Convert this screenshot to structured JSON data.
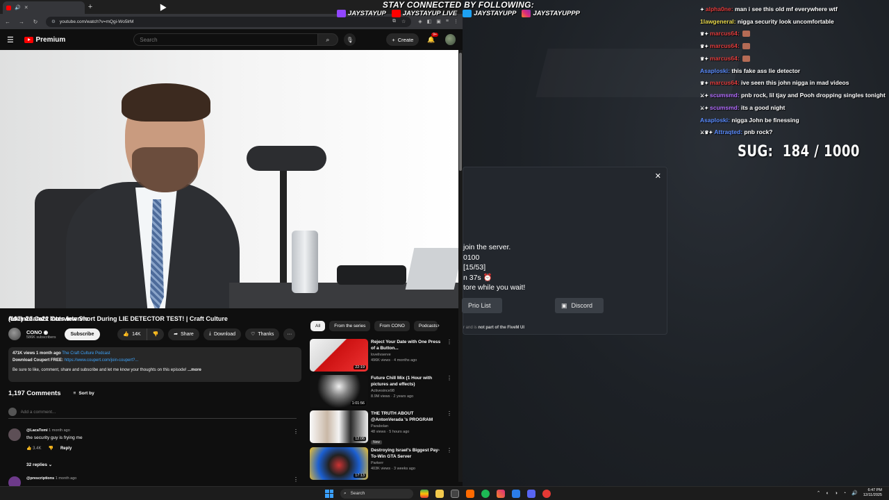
{
  "browser": {
    "tab_title": "(107) Adam22 Cuts Intervie",
    "url": "youtube.com/watch?v=mQgi-Wo5lrM"
  },
  "youtube": {
    "brand": "Premium",
    "search_placeholder": "Search",
    "create_label": "Create",
    "notif_count": "9+",
    "video_title": "Adam22 Cuts Interview Short During LIE DETECTOR TEST! | Craft Culture",
    "channel_name": "CONO",
    "channel_subs": "586K subscribers",
    "subscribe_label": "Subscribe",
    "likes": "14K",
    "share_label": "Share",
    "download_label": "Download",
    "thanks_label": "Thanks",
    "description": {
      "meta": "471K views  1 month ago",
      "podcast": "The Craft Culture Podcast",
      "coupon_label": "Download Coupert FREE:",
      "coupon_link": "https://www.coupert.com/join-coupert?...",
      "body": "Be sure to like, comment, share and subscribe and let me know your thoughts on this episode!",
      "more": "...more"
    },
    "comments_count": "1,197 Comments",
    "sort_label": "Sort by",
    "add_comment_placeholder": "Add a comment...",
    "comments": [
      {
        "author": "@LacaTomi",
        "time": "1 month ago",
        "text": "the security guy is frying me",
        "likes": "3.4K",
        "reply": "Reply"
      },
      {
        "author": "@prescriptions",
        "time": "1 month ago"
      }
    ],
    "replies_label": "32 replies",
    "chips": [
      "All",
      "From the series",
      "From CONO",
      "Podcasts"
    ],
    "recommendations": [
      {
        "title": "Reject Your Date with One Press of a Button...",
        "channel": "lovelivserve",
        "meta": "496K views · 4 months ago",
        "duration": "22:19"
      },
      {
        "title": "Future Chill Mix (1 Hour with pictures and effects)",
        "channel": "Activesince98",
        "meta": "8.9M views · 2 years ago",
        "duration": "1:01:56"
      },
      {
        "title": "THE TRUTH ABOUT @AntonVerada 's PROGRAM",
        "channel": "Parabolan",
        "meta": "48 views · 5 hours ago",
        "duration": "12:06",
        "badge": "New"
      },
      {
        "title": "Destroying Israel's Biggest Pay-To-Win GTA Server",
        "channel": "Parkerr",
        "meta": "403K views · 3 weeks ago",
        "duration": "17:13"
      }
    ]
  },
  "overlay": {
    "follow_title": "STAY CONNECTED BY FOLLOWING:",
    "handles": [
      "JAYSTAYUP",
      "JAYSTAYUP LIVE",
      "JAYSTAYUPP",
      "JAYSTAYUPPP"
    ],
    "sug_label": "SUG:",
    "sug_value": "184 / 1000",
    "chat": [
      {
        "user": "alpha0ne:",
        "msg": "man i see this old mf everywhere wtf",
        "color": "red"
      },
      {
        "user": "1lawgeneral:",
        "msg": "nigga security look uncomfortable",
        "color": "yellow"
      },
      {
        "user": "marcus64:",
        "msg": "",
        "color": "red"
      },
      {
        "user": "marcus64:",
        "msg": "",
        "color": "red"
      },
      {
        "user": "marcus64:",
        "msg": "",
        "color": "red"
      },
      {
        "user": "Asaploski:",
        "msg": "this fake ass lie detector",
        "color": "blue"
      },
      {
        "user": "marcus64:",
        "msg": "ive seen this john nigga in mad videos",
        "color": "red"
      },
      {
        "user": "scumsmd:",
        "msg": "pnb rock, lil tjay and Pooh dropping singles tonight",
        "color": "purple"
      },
      {
        "user": "scumsmd:",
        "msg": "its a good night",
        "color": "purple"
      },
      {
        "user": "Asaploski:",
        "msg": "nigga John be finessing",
        "color": "blue"
      },
      {
        "user": "Attraqted:",
        "msg": "pnb rock?",
        "color": "blue"
      }
    ],
    "queue": {
      "lines": [
        "join the server.",
        "0100",
        "[15/53]",
        "n 37s ⏰",
        "tore while you wait!"
      ],
      "prio_label": "Prio List",
      "discord_label": "Discord",
      "note_prefix": "r and is",
      "note_bold": "not part of the FiveM UI"
    }
  },
  "taskbar": {
    "search_label": "Search",
    "time": "6:47 PM",
    "date": "12/11/2025"
  }
}
